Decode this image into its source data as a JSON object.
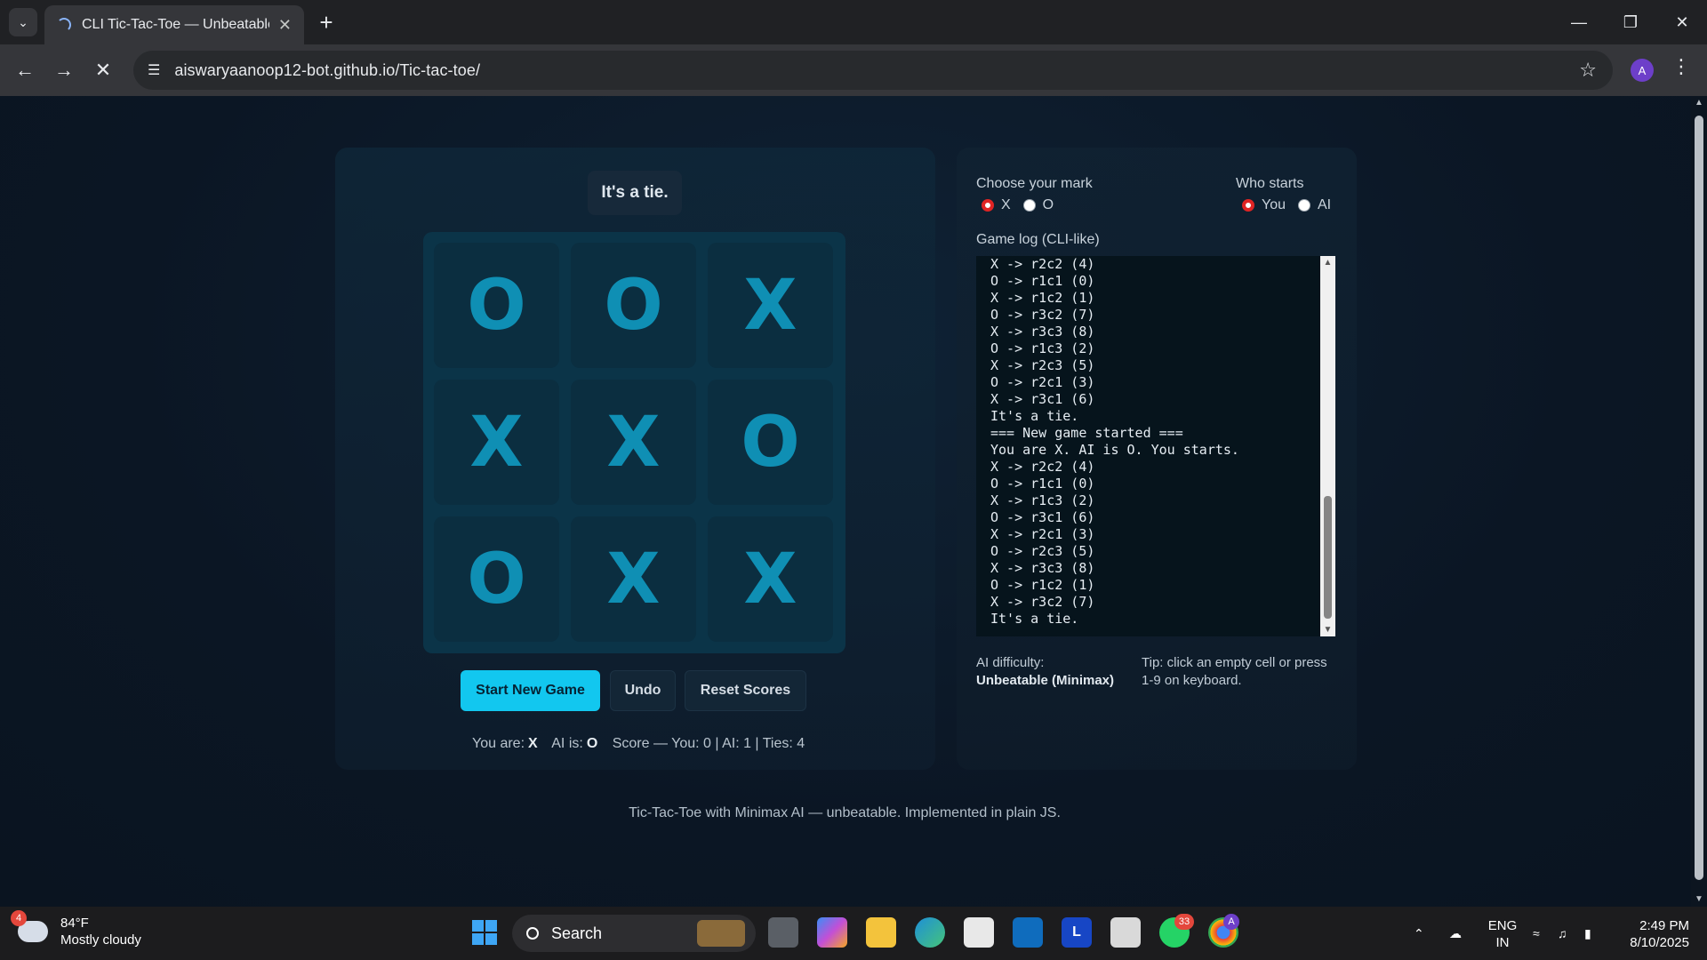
{
  "browser": {
    "tab_title": "CLI Tic-Tac-Toe — Unbeatable AI",
    "url": "aiswaryaanoop12-bot.github.io/Tic-tac-toe/",
    "profile_initial": "A"
  },
  "game": {
    "status": "It's a tie.",
    "board": [
      "O",
      "O",
      "X",
      "X",
      "X",
      "O",
      "O",
      "X",
      "X"
    ],
    "buttons": {
      "start": "Start New Game",
      "undo": "Undo",
      "reset": "Reset Scores"
    },
    "meta": {
      "you_are_label": "You are:",
      "you_are": "X",
      "ai_is_label": "AI is:",
      "ai_is": "O",
      "score": "Score — You: 0 | AI: 1 | Ties: 4"
    }
  },
  "settings": {
    "mark_label": "Choose your mark",
    "mark_options": [
      "X",
      "O"
    ],
    "mark_selected": "X",
    "starts_label": "Who starts",
    "starts_options": [
      "You",
      "AI"
    ],
    "starts_selected": "You",
    "log_label": "Game log (CLI-like)",
    "log_lines": [
      "X -> r2c2 (4)",
      "O -> r1c1 (0)",
      "X -> r1c2 (1)",
      "O -> r3c2 (7)",
      "X -> r3c3 (8)",
      "O -> r1c3 (2)",
      "X -> r2c3 (5)",
      "O -> r2c1 (3)",
      "X -> r3c1 (6)",
      "It's a tie.",
      "=== New game started ===",
      "You are X. AI is O. You starts.",
      "X -> r2c2 (4)",
      "O -> r1c1 (0)",
      "X -> r1c3 (2)",
      "O -> r3c1 (6)",
      "X -> r2c1 (3)",
      "O -> r2c3 (5)",
      "X -> r3c3 (8)",
      "O -> r1c2 (1)",
      "X -> r3c2 (7)",
      "It's a tie."
    ],
    "difficulty_label": "AI difficulty:",
    "difficulty_value": "Unbeatable (Minimax)",
    "tip_line1": "Tip: click an empty cell or press",
    "tip_line2": "1-9 on keyboard."
  },
  "footer": "Tic-Tac-Toe with Minimax AI — unbeatable. Implemented in plain JS.",
  "taskbar": {
    "weather_temp": "84°F",
    "weather_desc": "Mostly cloudy",
    "weather_badge": "4",
    "search_label": "Search",
    "whatsapp_badge": "33",
    "chrome_badge": "A",
    "lang_line1": "ENG",
    "lang_line2": "IN",
    "time": "2:49 PM",
    "date": "8/10/2025"
  },
  "colors": {
    "accent": "#12c7ef",
    "mark": "#0f8fb4",
    "radio_selected": "#e02424"
  }
}
